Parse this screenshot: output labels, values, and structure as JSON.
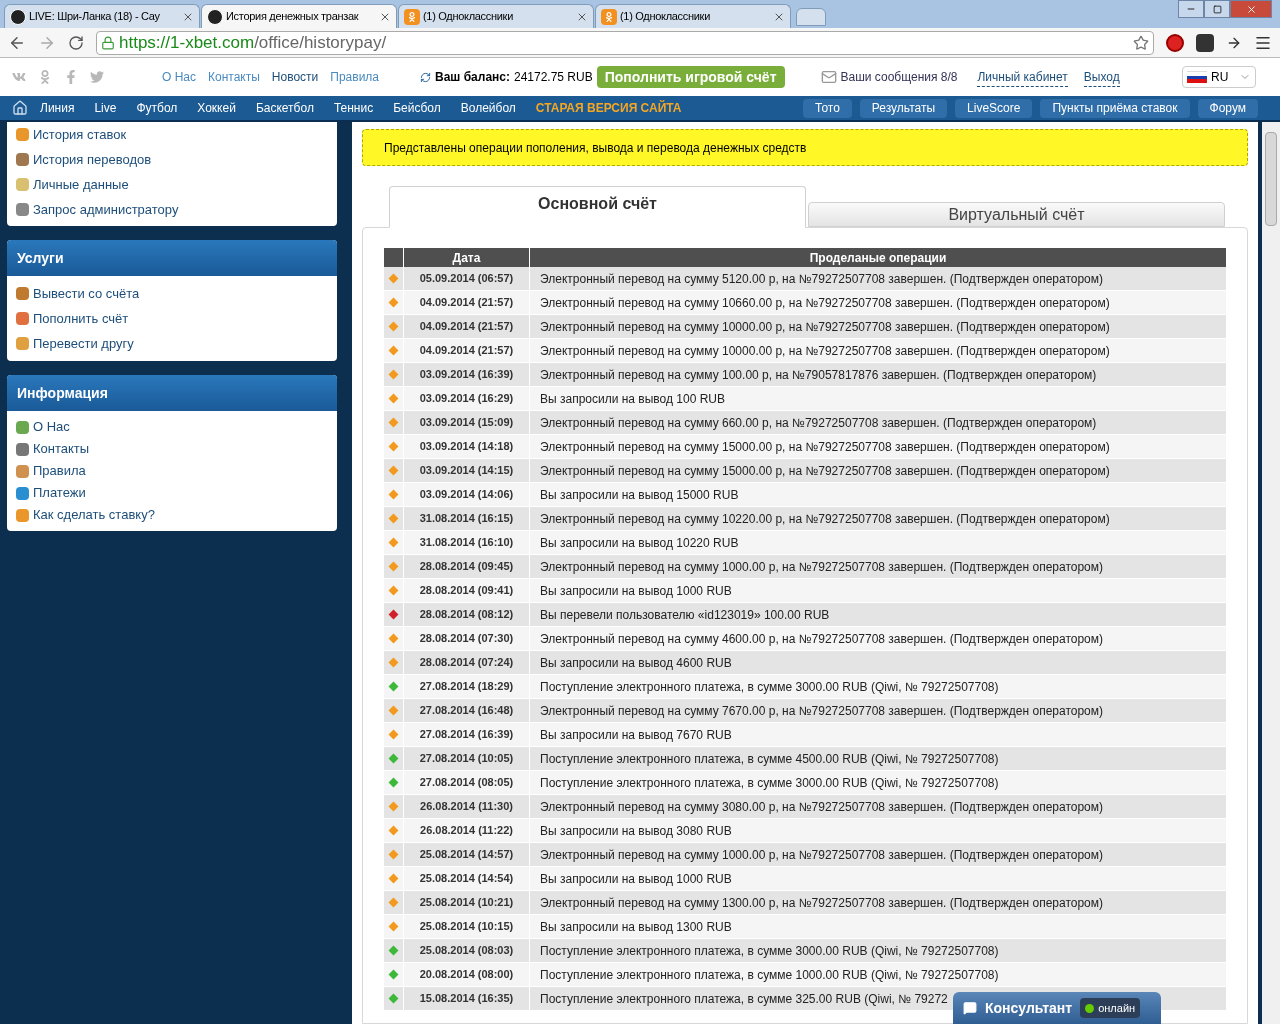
{
  "browser": {
    "tabs": [
      {
        "title": "LIVE: Шри-Ланка (18) - Сау",
        "selected": false,
        "kind": "site"
      },
      {
        "title": "История денежных транзак",
        "selected": true,
        "kind": "site"
      },
      {
        "title": "(1) Одноклассники",
        "selected": false,
        "kind": "ok"
      },
      {
        "title": "(1) Одноклассники",
        "selected": false,
        "kind": "ok"
      }
    ],
    "url_host": "https://1-xbet.com",
    "url_path": "/office/historypay/"
  },
  "header": {
    "links": [
      "О Нас",
      "Контакты",
      "Новости",
      "Правила"
    ],
    "balance_label": "Ваш баланс:",
    "balance_value": "24172.75 RUB",
    "deposit_button": "Пополнить игровой счёт",
    "messages": "Ваши сообщения 8/8",
    "account_links": [
      "Личный кабинет",
      "Выход"
    ],
    "language": "RU"
  },
  "nav": {
    "items": [
      "Линия",
      "Live",
      "Футбол",
      "Хоккей",
      "Баскетбол",
      "Теннис",
      "Бейсбол",
      "Волейбол"
    ],
    "highlight": "СТАРАЯ ВЕРСИЯ САЙТА",
    "buttons": [
      "Тото",
      "Результаты",
      "LiveScore",
      "Пункты приёма ставок",
      "Форум"
    ]
  },
  "sidebar": [
    {
      "items": [
        "История ставок",
        "История переводов",
        "Личные данные",
        "Запрос администратору"
      ]
    },
    {
      "title": "Услуги",
      "items": [
        "Вывести со счёта",
        "Пополнить счёт",
        "Перевести другу"
      ]
    },
    {
      "title": "Информация",
      "items": [
        "О Нас",
        "Контакты",
        "Правила",
        "Платежи",
        "Как сделать ставку?"
      ]
    }
  ],
  "notice": "Представлены операции пополения, вывода и перевода денежных средств",
  "account_tabs": [
    {
      "label": "Основной счёт",
      "selected": true
    },
    {
      "label": "Виртуальный счёт",
      "selected": false
    }
  ],
  "table": {
    "columns": [
      "Дата",
      "Проделаные операции"
    ],
    "rows": [
      {
        "kind": "out",
        "date": "05.09.2014 (06:57)",
        "text": "Электронный перевод на сумму 5120.00 р, на №79272507708 завершен. (Подтвержден оператором)"
      },
      {
        "kind": "out",
        "date": "04.09.2014 (21:57)",
        "text": "Электронный перевод на сумму 10660.00 р, на №79272507708 завершен. (Подтвержден оператором)"
      },
      {
        "kind": "out",
        "date": "04.09.2014 (21:57)",
        "text": "Электронный перевод на сумму 10000.00 р, на №79272507708 завершен. (Подтвержден оператором)"
      },
      {
        "kind": "out",
        "date": "04.09.2014 (21:57)",
        "text": "Электронный перевод на сумму 10000.00 р, на №79272507708 завершен. (Подтвержден оператором)"
      },
      {
        "kind": "out",
        "date": "03.09.2014 (16:39)",
        "text": "Электронный перевод на сумму 100.00 р, на №79057817876 завершен. (Подтвержден оператором)"
      },
      {
        "kind": "out",
        "date": "03.09.2014 (16:29)",
        "text": "Вы запросили на вывод 100 RUB"
      },
      {
        "kind": "out",
        "date": "03.09.2014 (15:09)",
        "text": "Электронный перевод на сумму 660.00 р, на №79272507708 завершен. (Подтвержден оператором)"
      },
      {
        "kind": "out",
        "date": "03.09.2014 (14:18)",
        "text": "Электронный перевод на сумму 15000.00 р, на №79272507708 завершен. (Подтвержден оператором)"
      },
      {
        "kind": "out",
        "date": "03.09.2014 (14:15)",
        "text": "Электронный перевод на сумму 15000.00 р, на №79272507708 завершен. (Подтвержден оператором)"
      },
      {
        "kind": "out",
        "date": "03.09.2014 (14:06)",
        "text": "Вы запросили на вывод 15000 RUB"
      },
      {
        "kind": "out",
        "date": "31.08.2014 (16:15)",
        "text": "Электронный перевод на сумму 10220.00 р, на №79272507708 завершен. (Подтвержден оператором)"
      },
      {
        "kind": "out",
        "date": "31.08.2014 (16:10)",
        "text": "Вы запросили на вывод 10220 RUB"
      },
      {
        "kind": "out",
        "date": "28.08.2014 (09:45)",
        "text": "Электронный перевод на сумму 1000.00 р, на №79272507708 завершен. (Подтвержден оператором)"
      },
      {
        "kind": "out",
        "date": "28.08.2014 (09:41)",
        "text": "Вы запросили на вывод 1000 RUB"
      },
      {
        "kind": "transfer",
        "date": "28.08.2014 (08:12)",
        "text": "Вы перевели пользователю «id123019» 100.00 RUB"
      },
      {
        "kind": "out",
        "date": "28.08.2014 (07:30)",
        "text": "Электронный перевод на сумму 4600.00 р, на №79272507708 завершен. (Подтвержден оператором)"
      },
      {
        "kind": "out",
        "date": "28.08.2014 (07:24)",
        "text": "Вы запросили на вывод 4600 RUB"
      },
      {
        "kind": "in",
        "date": "27.08.2014 (18:29)",
        "text": "Поступление электронного платежа, в сумме 3000.00 RUB (Qiwi, № 79272507708)"
      },
      {
        "kind": "out",
        "date": "27.08.2014 (16:48)",
        "text": "Электронный перевод на сумму 7670.00 р, на №79272507708 завершен. (Подтвержден оператором)"
      },
      {
        "kind": "out",
        "date": "27.08.2014 (16:39)",
        "text": "Вы запросили на вывод 7670 RUB"
      },
      {
        "kind": "in",
        "date": "27.08.2014 (10:05)",
        "text": "Поступление электронного платежа, в сумме 4500.00 RUB (Qiwi, № 79272507708)"
      },
      {
        "kind": "in",
        "date": "27.08.2014 (08:05)",
        "text": "Поступление электронного платежа, в сумме 3000.00 RUB (Qiwi, № 79272507708)"
      },
      {
        "kind": "out",
        "date": "26.08.2014 (11:30)",
        "text": "Электронный перевод на сумму 3080.00 р, на №79272507708 завершен. (Подтвержден оператором)"
      },
      {
        "kind": "out",
        "date": "26.08.2014 (11:22)",
        "text": "Вы запросили на вывод 3080 RUB"
      },
      {
        "kind": "out",
        "date": "25.08.2014 (14:57)",
        "text": "Электронный перевод на сумму 1000.00 р, на №79272507708 завершен. (Подтвержден оператором)"
      },
      {
        "kind": "out",
        "date": "25.08.2014 (14:54)",
        "text": "Вы запросили на вывод 1000 RUB"
      },
      {
        "kind": "out",
        "date": "25.08.2014 (10:21)",
        "text": "Электронный перевод на сумму 1300.00 р, на №79272507708 завершен. (Подтвержден оператором)"
      },
      {
        "kind": "out",
        "date": "25.08.2014 (10:15)",
        "text": "Вы запросили на вывод 1300 RUB"
      },
      {
        "kind": "in",
        "date": "25.08.2014 (08:03)",
        "text": "Поступление электронного платежа, в сумме 3000.00 RUB (Qiwi, № 79272507708)"
      },
      {
        "kind": "in",
        "date": "20.08.2014 (08:00)",
        "text": "Поступление электронного платежа, в сумме 1000.00 RUB (Qiwi, № 79272507708)"
      },
      {
        "kind": "in",
        "date": "15.08.2014 (16:35)",
        "text": "Поступление электронного платежа, в сумме 325.00 RUB (Qiwi, № 79272"
      }
    ]
  },
  "consultant": {
    "label": "Консультант",
    "status": "онлайн"
  }
}
